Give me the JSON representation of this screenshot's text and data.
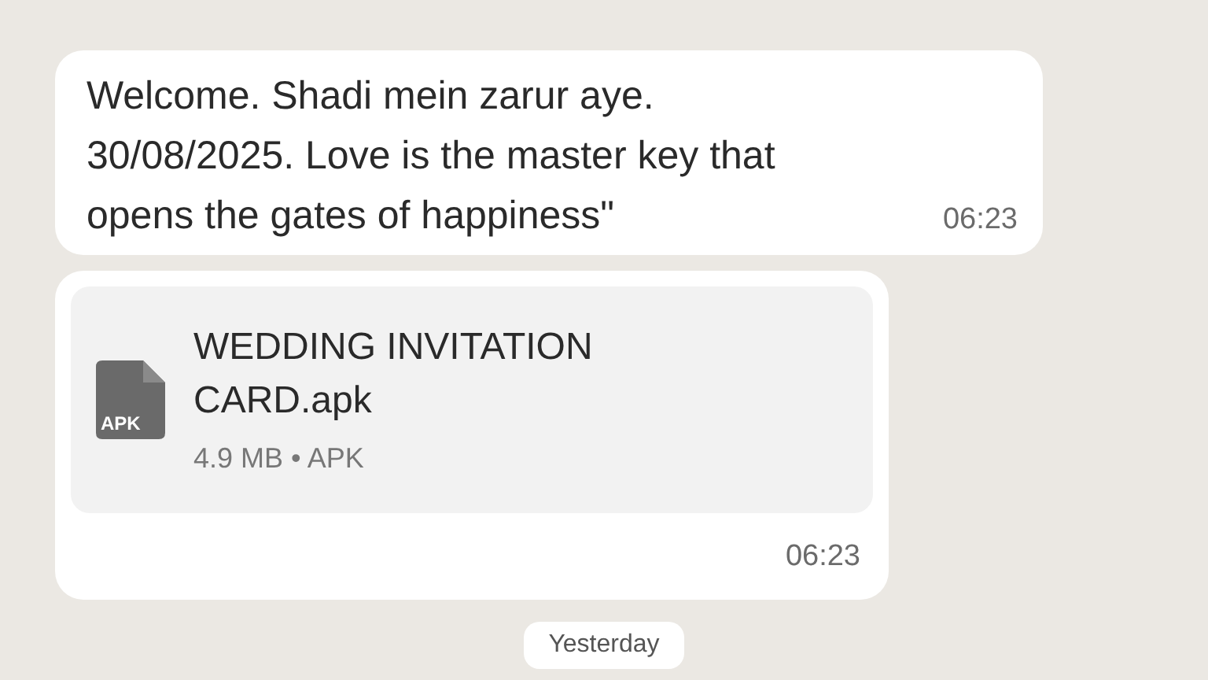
{
  "messages": [
    {
      "kind": "text",
      "lines": [
        "Welcome. Shadi mein zarur aye.",
        "30/08/2025. Love is the master key that",
        "opens the gates of happiness\""
      ],
      "time": "06:23"
    },
    {
      "kind": "document",
      "file_name_lines": [
        "WEDDING INVITATION",
        "CARD.apk"
      ],
      "file_type_badge": "APK",
      "file_info": "4.9 MB • APK",
      "time": "06:23"
    }
  ],
  "date_divider": "Yesterday"
}
